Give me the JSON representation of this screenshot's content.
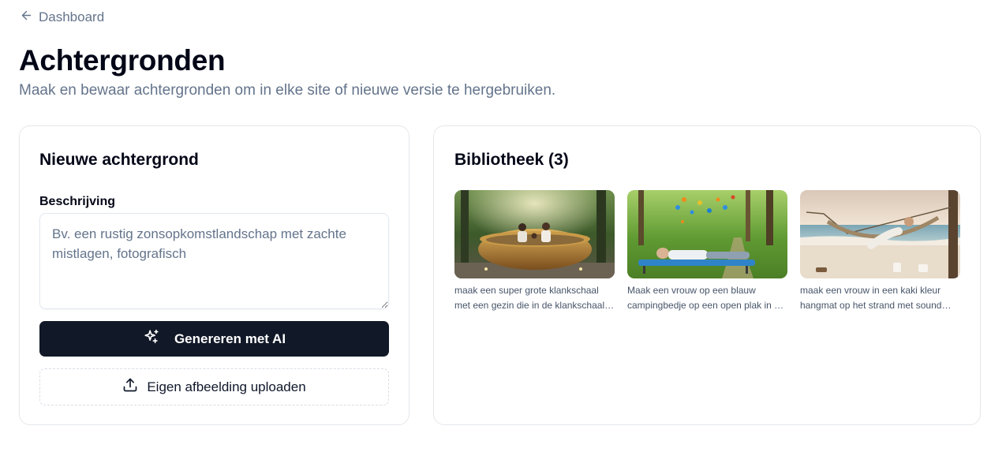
{
  "nav": {
    "back_label": "Dashboard"
  },
  "header": {
    "title": "Achtergronden",
    "subtitle": "Maak en bewaar achtergronden om in elke site of nieuwe versie te hergebruiken."
  },
  "new_background": {
    "title": "Nieuwe achtergrond",
    "description_label": "Beschrijving",
    "description_value": "",
    "description_placeholder": "Bv. een rustig zonsopkomstlandschap met zachte mistlagen, fotografisch",
    "generate_label": "Genereren met AI",
    "upload_label": "Eigen afbeelding uploaden"
  },
  "library": {
    "title": "Bibliotheek (3)",
    "items": [
      {
        "caption": "maak een super grote klankschaal met een gezin die in de klankschaal zit"
      },
      {
        "caption": "Maak een vrouw op een blauw campingbedje op een open plak in het bos"
      },
      {
        "caption": "maak een vrouw in een kaki kleur hangmat op het strand met sound healing"
      }
    ]
  },
  "icons": {
    "back": "arrow-left-icon",
    "generate": "sparkles-icon",
    "upload": "upload-icon"
  },
  "colors": {
    "primary_button": "#111827",
    "muted_text": "#64748b",
    "border": "#e5e7eb"
  }
}
